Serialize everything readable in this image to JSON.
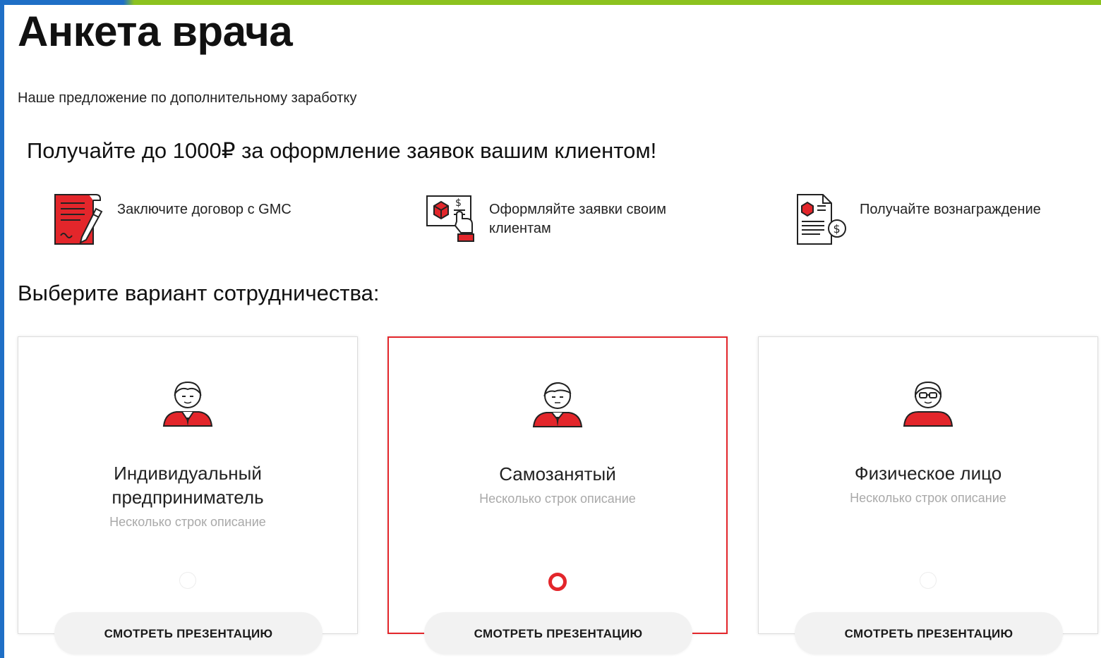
{
  "header": {
    "title": "Анкета врача",
    "subtitle": "Наше предложение по дополнительному заработку"
  },
  "offer": {
    "heading": "Получайте до 1000₽ за оформление заявок вашим клиентом!",
    "steps": [
      {
        "icon": "contract-document-icon",
        "text": "Заключите договор с GMC"
      },
      {
        "icon": "order-application-icon",
        "text": "Оформляйте заявки своим клиентам"
      },
      {
        "icon": "reward-invoice-icon",
        "text": "Получайте вознаграждение"
      }
    ]
  },
  "cooperation": {
    "heading": "Выберите вариант сотрудничества:",
    "options": [
      {
        "title": "Индивидуальный предприниматель",
        "description": "Несколько строк описание",
        "selected": false,
        "button": "СМОТРЕТЬ ПРЕЗЕНТАЦИЮ",
        "icon": "businessman-avatar-icon"
      },
      {
        "title": "Самозанятый",
        "description": "Несколько строк описание",
        "selected": true,
        "button": "СМОТРЕТЬ ПРЕЗЕНТАЦИЮ",
        "icon": "self-employed-avatar-icon"
      },
      {
        "title": "Физическое лицо",
        "description": "Несколько строк описание",
        "selected": false,
        "button": "СМОТРЕТЬ ПРЕЗЕНТАЦИЮ",
        "icon": "person-avatar-icon"
      }
    ]
  },
  "colors": {
    "accent": "#e3262b",
    "top_bar_blue": "#1f6fc6",
    "top_bar_green": "#8cc21f",
    "muted_text": "#a9a9a9",
    "button_bg": "#f2f2f2"
  }
}
